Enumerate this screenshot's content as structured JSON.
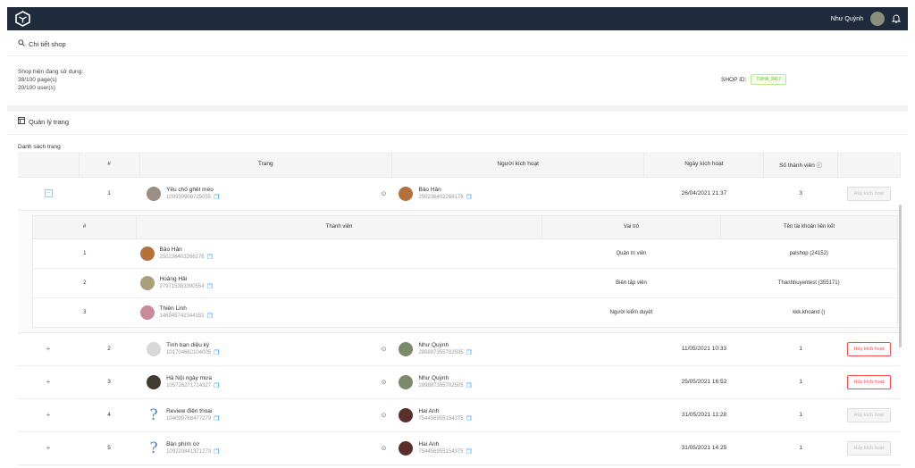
{
  "header": {
    "user_name": "Như Quỳnh",
    "logo_icon": "cube-logo-icon",
    "bell_icon": "bell-icon"
  },
  "shop_detail": {
    "title": "Chi tiết shop",
    "in_use_label": "Shop hiện đang sử dụng:",
    "pages_usage": "38/100 page(s)",
    "users_usage": "20/100 user(s)",
    "shop_id_label": "SHOP ID:",
    "shop_id_value": "TUHA_2417"
  },
  "page_management": {
    "title": "Quản lý trang",
    "list_label": "Danh sách trang"
  },
  "table": {
    "headers": {
      "index": "#",
      "page": "Trang",
      "activator": "Người kích hoạt",
      "activated_at": "Ngày kích hoạt",
      "member_count": "Số thành viên"
    },
    "rows": [
      {
        "index": "1",
        "page_name": "Yêu chó ghét mèo",
        "page_id": "100930908725055",
        "activator_name": "Bảo Hân",
        "activator_id": "250236403266176",
        "activated_at": "26/04/2021 21:37",
        "members": "3",
        "action": "Hủy kích hoạt",
        "action_style": "disabled",
        "expander": "−",
        "page_thumb": "#9a8f86",
        "person_thumb": "#b5713a",
        "qmark": false
      },
      {
        "index": "2",
        "page_name": "Tình bạn diệu kỳ",
        "page_id": "101704662104005",
        "activator_name": "Như Quỳnh",
        "activator_id": "289887355702505",
        "activated_at": "11/05/2021 10:33",
        "members": "1",
        "action": "Hủy kích hoạt",
        "action_style": "danger",
        "expander": "+",
        "page_thumb": "#d8d8d8",
        "person_thumb": "#7d8a6a",
        "qmark": false
      },
      {
        "index": "3",
        "page_name": "Hà Nội ngày mưa",
        "page_id": "105726271714327",
        "activator_name": "Như Quỳnh",
        "activator_id": "289887355702505",
        "activated_at": "25/05/2021 16:52",
        "members": "1",
        "action": "Hủy kích hoạt",
        "action_style": "danger",
        "expander": "+",
        "page_thumb": "#3f3a33",
        "person_thumb": "#7d8a6a",
        "qmark": false
      },
      {
        "index": "4",
        "page_name": "Review điện thoại",
        "page_id": "104099768477279",
        "activator_name": "Hai Anh",
        "activator_id": "754456955154375",
        "activated_at": "31/05/2021 11:28",
        "members": "1",
        "action": "Hủy kích hoạt",
        "action_style": "disabled",
        "expander": "+",
        "page_thumb": "",
        "person_thumb": "#5a2e2a",
        "qmark": true,
        "qmark_char": "?"
      },
      {
        "index": "5",
        "page_name": "Bàn phím cơ",
        "page_id": "109220841371273",
        "activator_name": "Hai Anh",
        "activator_id": "754456955154375",
        "activated_at": "31/05/2021 14:25",
        "members": "1",
        "action": "Hủy kích hoạt",
        "action_style": "disabled",
        "expander": "+",
        "page_thumb": "",
        "person_thumb": "#5a2e2a",
        "qmark": true,
        "qmark_char": "?"
      }
    ]
  },
  "subtable": {
    "headers": {
      "index": "#",
      "member": "Thành viên",
      "role": "Vai trò",
      "linked_account": "Tên tài khoản liên kết"
    },
    "rows": [
      {
        "index": "1",
        "name": "Bảo Hân",
        "id": "250236403266176",
        "role": "Quản trị viên",
        "account": "palshop (24152)",
        "thumb": "#b5713a"
      },
      {
        "index": "2",
        "name": "Hoàng Hải",
        "id": "279715383390554",
        "role": "Biên tập viên",
        "account": "Thanhhuyentest (355171)",
        "thumb": "#a9a07a"
      },
      {
        "index": "3",
        "name": "Thiên Linh",
        "id": "146945742344181",
        "role": "Người kiểm duyệt",
        "account": "kkk.khoand ()",
        "thumb": "#c98a9a"
      }
    ]
  }
}
